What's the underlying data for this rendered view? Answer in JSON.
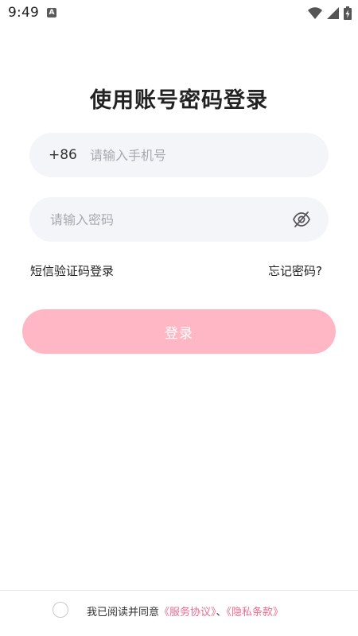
{
  "status_bar": {
    "time": "9:49",
    "notification_icon": "A"
  },
  "title": "使用账号密码登录",
  "phone_field": {
    "country_code": "+86",
    "placeholder": "请输入手机号",
    "value": ""
  },
  "password_field": {
    "placeholder": "请输入密码",
    "value": ""
  },
  "links": {
    "sms_login": "短信验证码登录",
    "forgot_password": "忘记密码?"
  },
  "login_button": {
    "label": "登录"
  },
  "agreement": {
    "prefix": "我已阅读并同意",
    "service_link": "《服务协议》",
    "separator": "、",
    "privacy_link": "《隐私条款》",
    "checked": false
  },
  "colors": {
    "accent": "#ffb7c5",
    "link": "#f06b8f",
    "field_bg": "#f4f5f9"
  }
}
